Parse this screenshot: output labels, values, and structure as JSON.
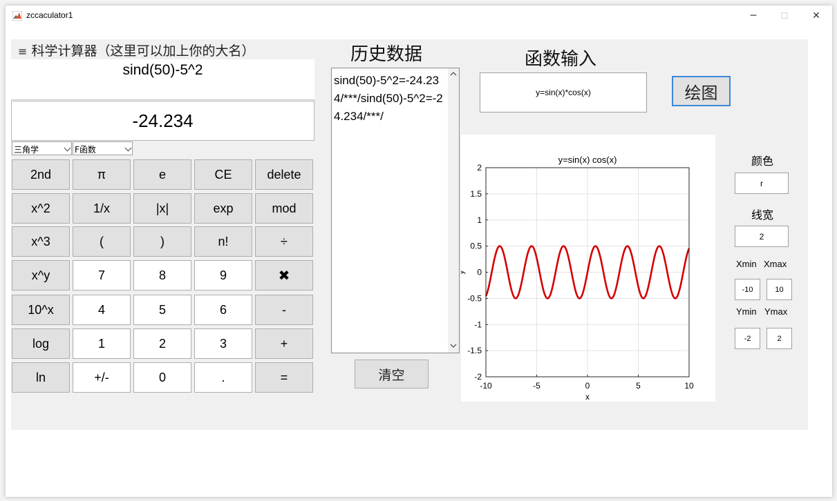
{
  "window": {
    "title": "zccaculator1",
    "controls": {
      "minimize": "─",
      "maximize": "☐",
      "close": "✕"
    }
  },
  "calculator": {
    "menu_icon": "≡",
    "heading": "科学计算器（这里可以加上你的大名）",
    "expression": "sind(50)-5^2",
    "result": "-24.234",
    "dropdowns": [
      {
        "label": "三角学"
      },
      {
        "label": "F函数"
      }
    ],
    "keys": [
      [
        "2nd",
        "π",
        "e",
        "CE",
        "delete"
      ],
      [
        "x^2",
        "1/x",
        "|x|",
        "exp",
        "mod"
      ],
      [
        "x^3",
        "(",
        ")",
        "n!",
        "÷"
      ],
      [
        "x^y",
        "7",
        "8",
        "9",
        "✖"
      ],
      [
        "10^x",
        "4",
        "5",
        "6",
        "-"
      ],
      [
        "log",
        "1",
        "2",
        "3",
        "+"
      ],
      [
        "ln",
        "+/-",
        "0",
        ".",
        "="
      ]
    ]
  },
  "history": {
    "title": "历史数据",
    "content": "sind(50)-5^2=-24.234/***/sind(50)-5^2=-24.234/***/",
    "clear_button": "清空"
  },
  "function_input": {
    "title": "函数输入",
    "expression": "y=sin(x)*cos(x)",
    "plot_button": "绘图"
  },
  "settings": {
    "color_label": "颜色",
    "color_value": "r",
    "linewidth_label": "线宽",
    "linewidth_value": "2",
    "xmin_label": "Xmin",
    "xmax_label": "Xmax",
    "xmin_value": "-10",
    "xmax_value": "10",
    "ymin_label": "Ymin",
    "ymax_label": "Ymax",
    "ymin_value": "-2",
    "ymax_value": "2"
  },
  "chart_data": {
    "type": "line",
    "title": "y=sin(x) cos(x)",
    "xlabel": "x",
    "ylabel": "y",
    "xlim": [
      -10,
      10
    ],
    "ylim": [
      -2,
      2
    ],
    "xticks": [
      -10,
      -5,
      0,
      5,
      10
    ],
    "yticks": [
      -2,
      -1.5,
      -1,
      -0.5,
      0,
      0.5,
      1,
      1.5,
      2
    ],
    "grid": true,
    "series": [
      {
        "function": "sin(x)*cos(x)",
        "x": [
          -10,
          -9.5,
          -9,
          -8.5,
          -8,
          -7.5,
          -7,
          -6.5,
          -6,
          -5.5,
          -5,
          -4.5,
          -4,
          -3.5,
          -3,
          -2.5,
          -2,
          -1.5,
          -1,
          -0.5,
          0,
          0.5,
          1,
          1.5,
          2,
          2.5,
          3,
          3.5,
          4,
          4.5,
          5,
          5.5,
          6,
          6.5,
          7,
          7.5,
          8,
          8.5,
          9,
          9.5,
          10
        ],
        "y": [
          -0.456,
          0.075,
          0.375,
          -0.481,
          0.144,
          0.325,
          -0.495,
          0.21,
          0.268,
          -0.5,
          0.272,
          0.206,
          -0.495,
          0.328,
          0.14,
          -0.479,
          0.378,
          0.071,
          -0.455,
          0.421,
          0,
          -0.421,
          0.455,
          -0.071,
          -0.378,
          0.479,
          -0.14,
          -0.328,
          0.495,
          -0.206,
          -0.272,
          0.5,
          -0.268,
          -0.21,
          0.495,
          -0.325,
          -0.144,
          0.481,
          -0.375,
          -0.075,
          0.456
        ],
        "color": "#d40000"
      }
    ]
  }
}
